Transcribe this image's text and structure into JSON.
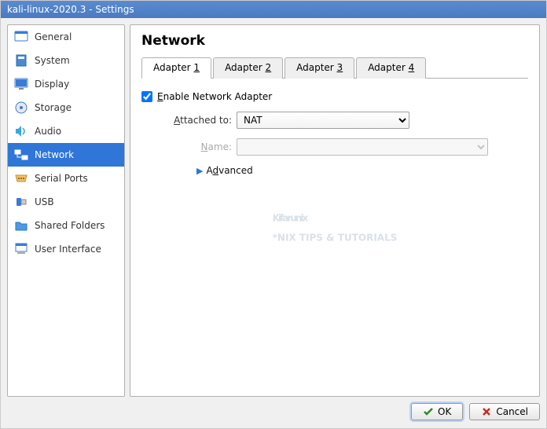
{
  "window": {
    "title": "kali-linux-2020.3 - Settings"
  },
  "sidebar": {
    "items": [
      {
        "label": "General"
      },
      {
        "label": "System"
      },
      {
        "label": "Display"
      },
      {
        "label": "Storage"
      },
      {
        "label": "Audio"
      },
      {
        "label": "Network"
      },
      {
        "label": "Serial Ports"
      },
      {
        "label": "USB"
      },
      {
        "label": "Shared Folders"
      },
      {
        "label": "User Interface"
      }
    ]
  },
  "panel": {
    "title": "Network",
    "tabs": [
      {
        "label": "Adapter 1"
      },
      {
        "label": "Adapter 2"
      },
      {
        "label": "Adapter 3"
      },
      {
        "label": "Adapter 4"
      }
    ],
    "enable_label": "Enable Network Adapter",
    "enable_checked": true,
    "attached_label": "Attached to:",
    "attached_value": "NAT",
    "name_label": "Name:",
    "name_value": "",
    "advanced_label": "Advanced"
  },
  "buttons": {
    "ok": "OK",
    "cancel": "Cancel"
  },
  "watermark": {
    "brand": "Kifarunix",
    "tag": "*NIX TIPS & TUTORIALS"
  }
}
